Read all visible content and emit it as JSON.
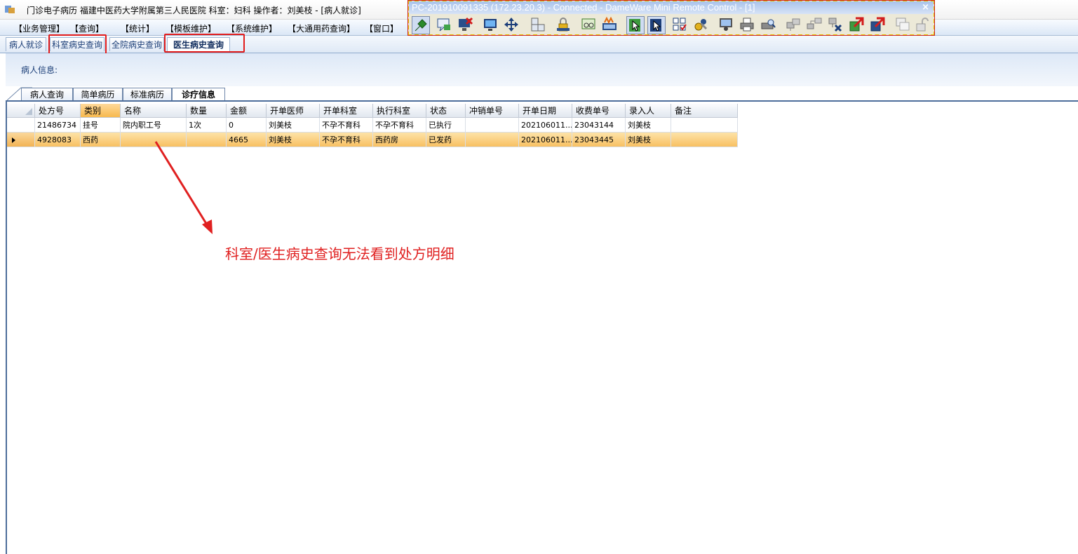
{
  "window": {
    "title": "门诊电子病历  福建中医药大学附属第三人民医院  科室：妇科  操作者：刘美枝 - [病人就诊]"
  },
  "menu": [
    "【业务管理】",
    "【查询】",
    "【统计】",
    "【模板维护】",
    "【系统维护】",
    "【大通用药查询】",
    "【窗口】"
  ],
  "remote_control": {
    "title": "PC-201910091335 (172.23.20.3) - Connected - DameWare Mini Remote Control - [1]",
    "close_glyph": "×"
  },
  "tabs": [
    "病人就诊",
    "科室病史查询",
    "全院病史查询",
    "医生病史查询"
  ],
  "active_tab": "医生病史查询",
  "patient_info_label": "病人信息:",
  "subtabs": [
    "病人查询",
    "简单病历",
    "标准病历",
    "诊疗信息"
  ],
  "active_subtab": "诊疗信息",
  "grid": {
    "columns": [
      "处方号",
      "类别",
      "名称",
      "数量",
      "金额",
      "开单医师",
      "开单科室",
      "执行科室",
      "状态",
      "冲销单号",
      "开单日期",
      "收费单号",
      "录入人",
      "备注"
    ],
    "rows": [
      [
        "21486734",
        "挂号",
        "院内职工号",
        "1次",
        "0",
        "刘美枝",
        "不孕不育科",
        "不孕不育科",
        "已执行",
        "",
        "202106011...",
        "23043144",
        "刘美枝",
        ""
      ],
      [
        "4928083",
        "西药",
        "",
        "",
        "4665",
        "刘美枝",
        "不孕不育科",
        "西药房",
        "已发药",
        "",
        "202106011...",
        "23043445",
        "刘美枝",
        ""
      ]
    ],
    "selected_row": 1
  },
  "annotation": {
    "text": "科室/医生病史查询无法看到处方明细",
    "color": "#e02020"
  }
}
